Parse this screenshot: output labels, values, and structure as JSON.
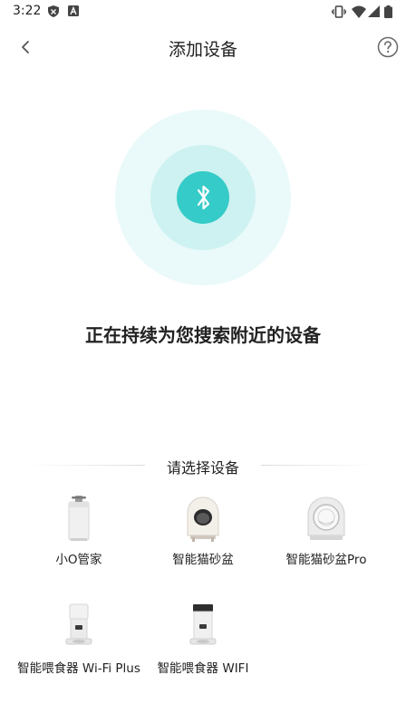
{
  "status_bar": {
    "time": "3:22",
    "left_icons": [
      "shield-icon",
      "a-badge-icon"
    ],
    "right_icons": [
      "vibrate-icon",
      "wifi-icon",
      "signal-icon",
      "battery-icon"
    ]
  },
  "header": {
    "title": "添加设备",
    "back_icon": "chevron-left-icon",
    "help_icon": "question-circle-icon"
  },
  "scan": {
    "icon": "bluetooth-icon",
    "status": "正在持续为您搜索附近的设备",
    "accent_color": "#35cbc8"
  },
  "device_section": {
    "title": "请选择设备",
    "devices": [
      {
        "label": "小O管家"
      },
      {
        "label": "智能猫砂盆"
      },
      {
        "label": "智能猫砂盆Pro"
      },
      {
        "label": "智能喂食器 Wi-Fi Plus"
      },
      {
        "label": "智能喂食器 WIFI"
      }
    ]
  }
}
